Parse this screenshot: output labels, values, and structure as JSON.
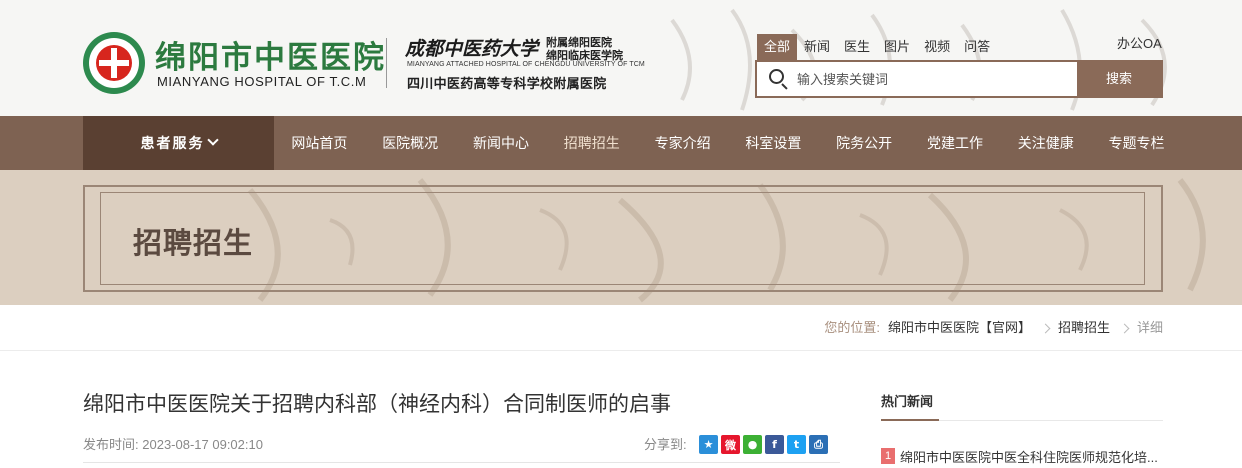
{
  "header": {
    "logo_cn": "绵阳市中医医院",
    "logo_en": "MIANYANG HOSPITAL OF T.C.M",
    "university_name": "成都中医药大学",
    "affiliation_1": "附属绵阳医院",
    "affiliation_2": "绵阳临床医学院",
    "university_en": "MIANYANG ATTACHED HOSPITAL OF CHENGDU UNIVERSITY OF TCM",
    "school_name": "四川中医药高等专科学校附属医院",
    "oa_link": "办公OA"
  },
  "search": {
    "tabs": [
      "全部",
      "新闻",
      "医生",
      "图片",
      "视频",
      "问答"
    ],
    "active_tab": 0,
    "placeholder": "输入搜索关键词",
    "value": "",
    "button": "搜索"
  },
  "nav": {
    "service_label": "患者服务",
    "items": [
      "网站首页",
      "医院概况",
      "新闻中心",
      "招聘招生",
      "专家介绍",
      "科室设置",
      "院务公开",
      "党建工作",
      "关注健康",
      "专题专栏"
    ],
    "active_index": 3
  },
  "banner": {
    "title": "招聘招生"
  },
  "breadcrumb": {
    "label": "您的位置:",
    "home": "绵阳市中医医院【官网】",
    "section": "招聘招生",
    "current": "详细"
  },
  "article": {
    "title": "绵阳市中医医院关于招聘内科部（神经内科）合同制医师的启事",
    "date_label": "发布时间:",
    "date": "2023-08-17 09:02:10",
    "share_label": "分享到:",
    "share_icons": [
      {
        "name": "qzone-icon",
        "glyph": "★",
        "color": "#2b8fd9"
      },
      {
        "name": "weibo-icon",
        "glyph": "微",
        "color": "#e6162d"
      },
      {
        "name": "wechat-icon",
        "glyph": "●",
        "color": "#3cb034"
      },
      {
        "name": "facebook-icon",
        "glyph": "f",
        "color": "#3b5998"
      },
      {
        "name": "twitter-icon",
        "glyph": "t",
        "color": "#1da1f2"
      },
      {
        "name": "print-icon",
        "glyph": "⎙",
        "color": "#2b6fb5"
      }
    ]
  },
  "sidebar": {
    "title": "热门新闻",
    "items": [
      {
        "rank": "1",
        "text": "绵阳市中医医院中医全科住院医师规范化培..."
      }
    ]
  },
  "colors": {
    "brand_brown": "#8a6a58",
    "nav_bg": "#7e6252",
    "nav_service_bg": "#5a4032",
    "logo_green": "#2c7a3f",
    "rank_red": "#e96e6e"
  }
}
